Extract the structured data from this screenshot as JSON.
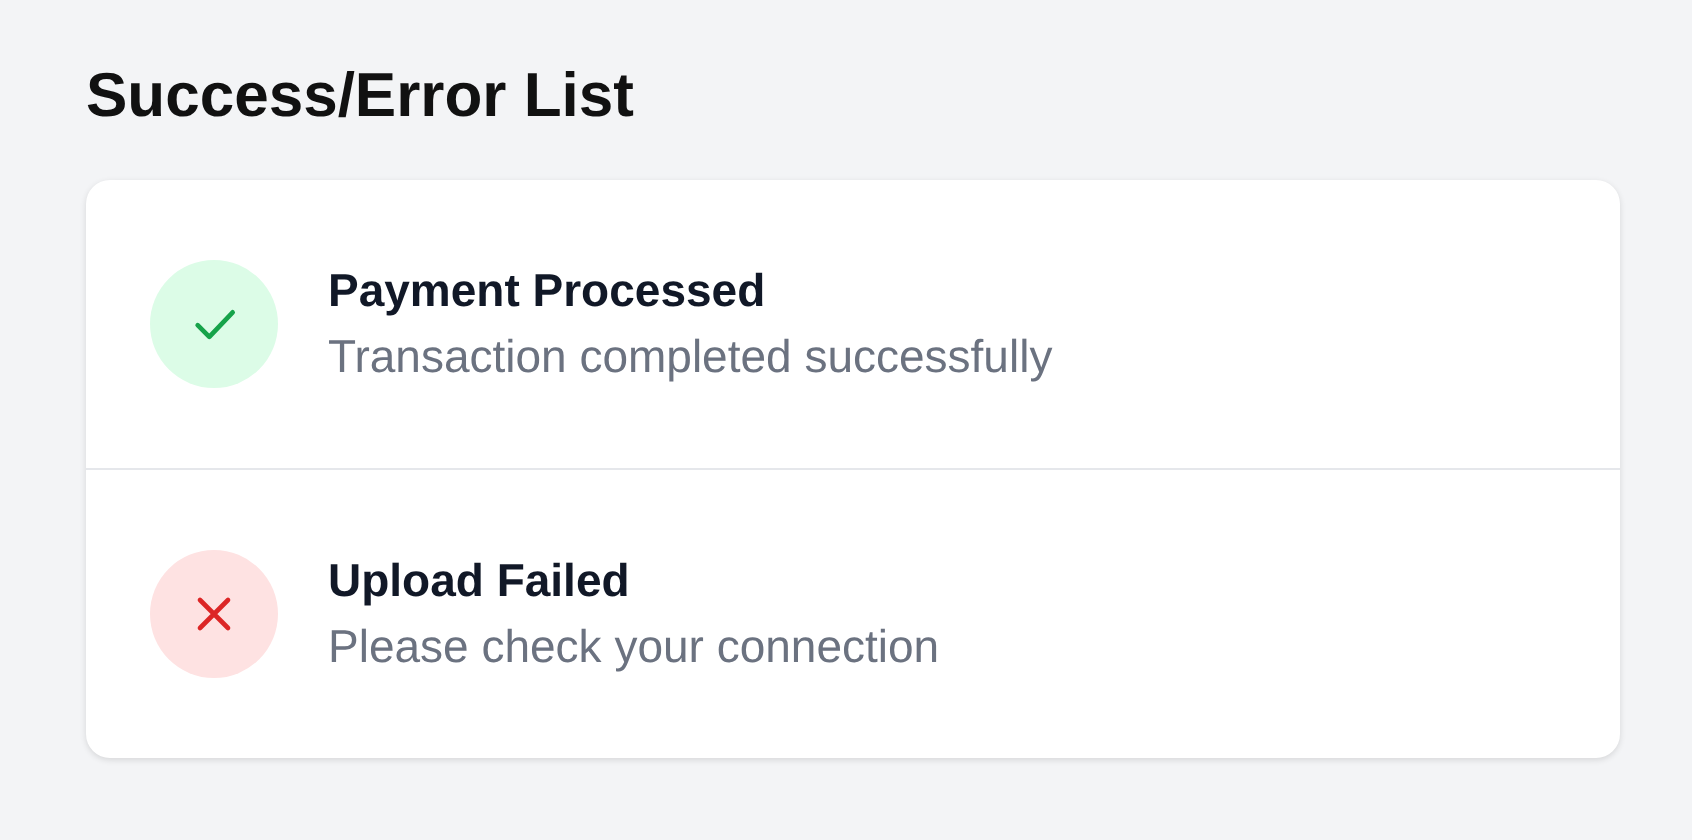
{
  "title": "Success/Error List",
  "items": [
    {
      "kind": "success",
      "title": "Payment Processed",
      "message": "Transaction completed successfully"
    },
    {
      "kind": "error",
      "title": "Upload Failed",
      "message": "Please check your connection"
    }
  ]
}
